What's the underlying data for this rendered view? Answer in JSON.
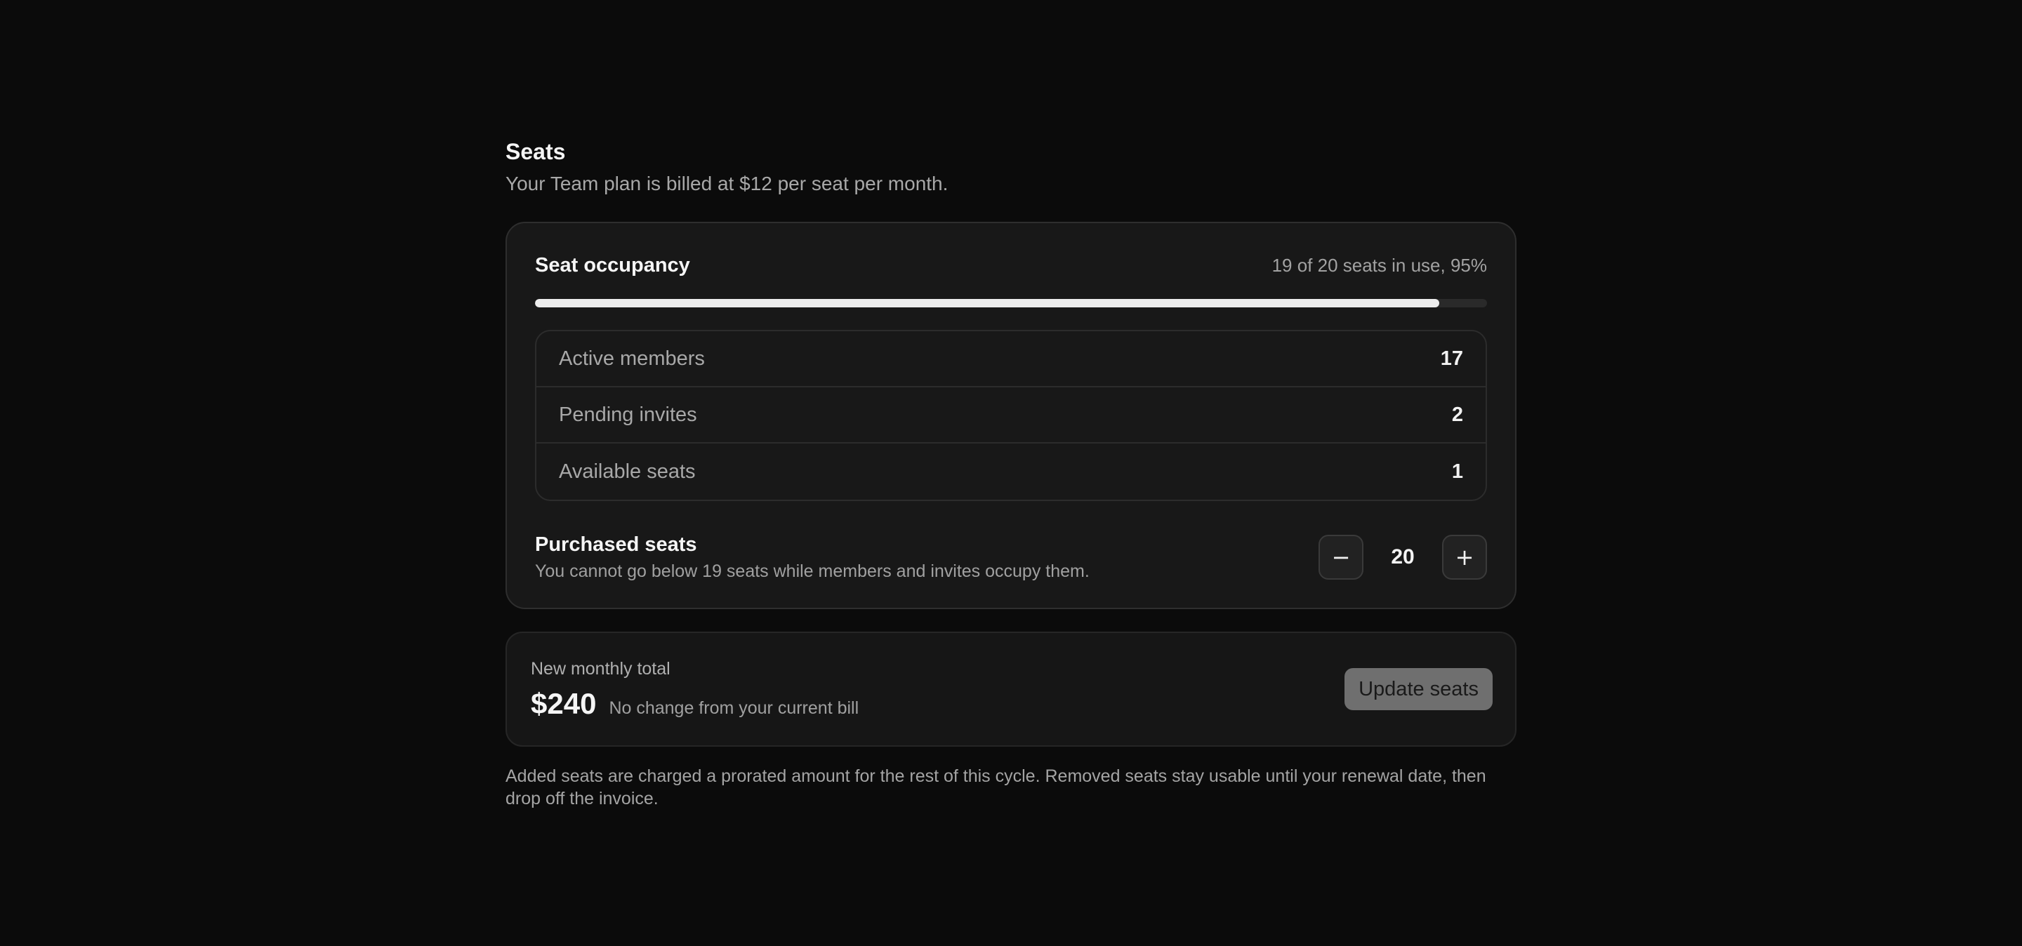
{
  "section": {
    "title": "Seats",
    "subtitle": "Your Team plan is billed at $12 per seat per month."
  },
  "occupancy": {
    "title": "Seat occupancy",
    "summary": "19 of 20 seats in use, 95%",
    "fill_percent": 95
  },
  "stats": [
    {
      "label": "Active members",
      "value": "17"
    },
    {
      "label": "Pending invites",
      "value": "2"
    },
    {
      "label": "Available seats",
      "value": "1"
    }
  ],
  "purchase": {
    "title": "Purchased seats",
    "note": "You cannot go below 19 seats while members and invites occupy them.",
    "decrement_label": "−",
    "value": "20",
    "increment_label": "+"
  },
  "total": {
    "label": "New monthly total",
    "amount": "$240",
    "change": "No change from your current bill",
    "update_button": "Update seats"
  },
  "footnote": "Added seats are charged a prorated amount for the rest of this cycle. Removed seats stay usable until your renewal date, then drop off the invoice."
}
